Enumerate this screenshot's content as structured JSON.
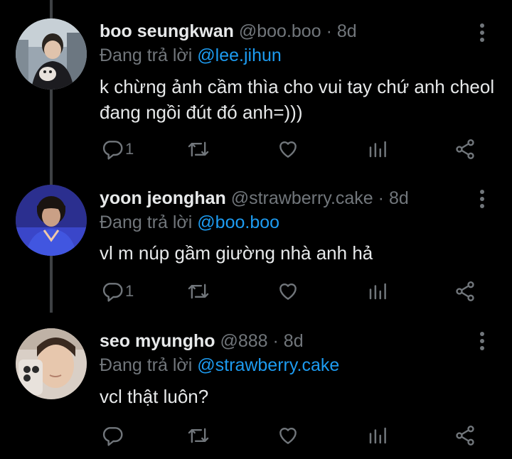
{
  "colors": {
    "background": "#000000",
    "text": "#e7e9ea",
    "muted": "#71767b",
    "link": "#1d9bf0",
    "thread_line": "#3e4144"
  },
  "tweets": [
    {
      "name": "boo seungkwan",
      "handle": "@boo.boo",
      "dot": "·",
      "time": "8d",
      "reply_prefix": "Đang trả lời",
      "reply_to": "@lee.jihun",
      "text": "k chừng ảnh cầm thìa cho vui tay chứ anh cheol đang ngồi đút đó anh=)))",
      "reply_count": "1",
      "icons": [
        "reply-icon",
        "retweet-icon",
        "like-icon",
        "views-icon",
        "share-icon"
      ]
    },
    {
      "name": "yoon jeonghan",
      "handle": "@strawberry.cake",
      "dot": "·",
      "time": "8d",
      "reply_prefix": "Đang trả lời",
      "reply_to": "@boo.boo",
      "text": "vl m núp gầm giường nhà anh hả",
      "reply_count": "1",
      "icons": [
        "reply-icon",
        "retweet-icon",
        "like-icon",
        "views-icon",
        "share-icon"
      ]
    },
    {
      "name": "seo myungho",
      "handle": "@888",
      "dot": "·",
      "time": "8d",
      "reply_prefix": "Đang trả lời",
      "reply_to": "@strawberry.cake",
      "text": "vcl thật luôn?",
      "reply_count": "",
      "icons": [
        "reply-icon",
        "retweet-icon",
        "like-icon",
        "views-icon",
        "share-icon"
      ]
    }
  ]
}
